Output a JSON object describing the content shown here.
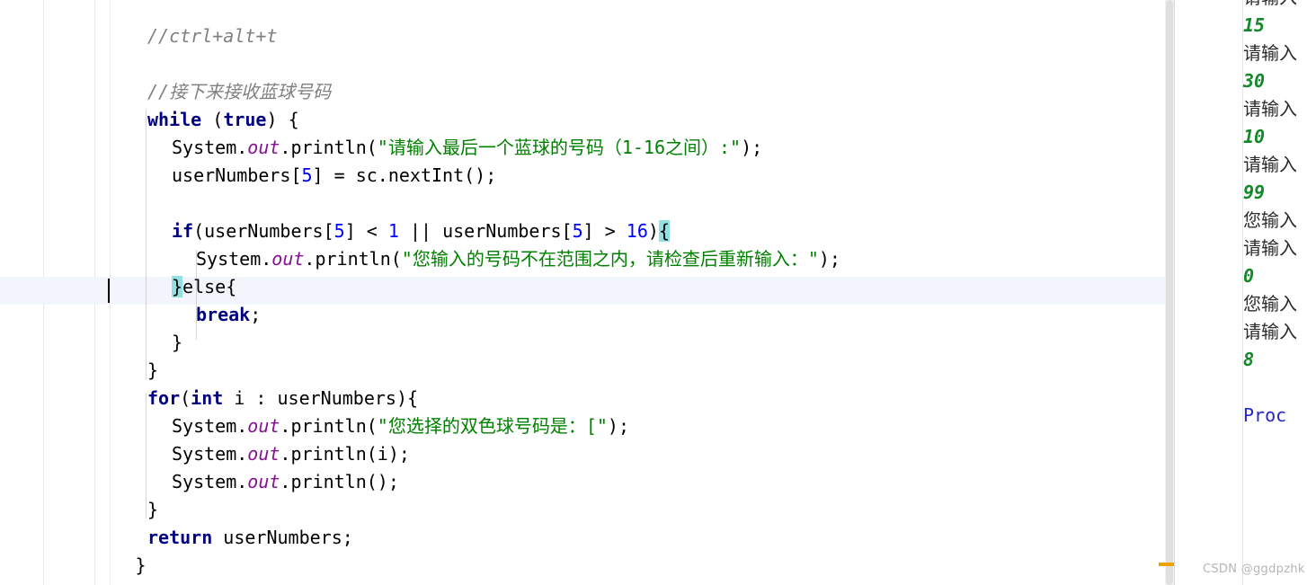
{
  "editor": {
    "language": "java",
    "theme": "IntelliJ Light",
    "font_size_px": 20,
    "line_height_px": 31,
    "caret_line_index": 9,
    "colors": {
      "comment": "#808080",
      "keyword": "#000080",
      "string": "#008000",
      "number": "#0000ff",
      "static_field": "#871094",
      "current_line_bg": "#f2f5fc",
      "bracket_match_bg": "#93e0e3",
      "warn_marker": "#eda200"
    },
    "lines": [
      {
        "indent": 4,
        "tokens": [
          {
            "t": "//ctrl+alt+t",
            "c": "cm"
          }
        ]
      },
      {
        "indent": 0,
        "tokens": []
      },
      {
        "indent": 4,
        "tokens": [
          {
            "t": "//接下来接收蓝球号码",
            "c": "cm"
          }
        ]
      },
      {
        "indent": 4,
        "tokens": [
          {
            "t": "while",
            "c": "kw"
          },
          {
            "t": " (",
            "c": "pl"
          },
          {
            "t": "true",
            "c": "kw"
          },
          {
            "t": ") {",
            "c": "pl"
          }
        ]
      },
      {
        "indent": 6,
        "tokens": [
          {
            "t": "System.",
            "c": "pl"
          },
          {
            "t": "out",
            "c": "fld"
          },
          {
            "t": ".println(",
            "c": "pl"
          },
          {
            "t": "\"请输入最后一个蓝球的号码（1-16之间）:\"",
            "c": "str"
          },
          {
            "t": ");",
            "c": "pl"
          }
        ]
      },
      {
        "indent": 6,
        "tokens": [
          {
            "t": "userNumbers[",
            "c": "pl"
          },
          {
            "t": "5",
            "c": "num"
          },
          {
            "t": "] = sc.nextInt();",
            "c": "pl"
          }
        ]
      },
      {
        "indent": 0,
        "tokens": []
      },
      {
        "indent": 6,
        "tokens": [
          {
            "t": "if",
            "c": "kw"
          },
          {
            "t": "(userNumbers[",
            "c": "pl"
          },
          {
            "t": "5",
            "c": "num"
          },
          {
            "t": "] < ",
            "c": "pl"
          },
          {
            "t": "1",
            "c": "num"
          },
          {
            "t": " || userNumbers[",
            "c": "pl"
          },
          {
            "t": "5",
            "c": "num"
          },
          {
            "t": "] > ",
            "c": "pl"
          },
          {
            "t": "16",
            "c": "num"
          },
          {
            "t": ")",
            "c": "pl"
          },
          {
            "t": "{",
            "c": "brmatch"
          }
        ]
      },
      {
        "indent": 8,
        "tokens": [
          {
            "t": "System.",
            "c": "pl"
          },
          {
            "t": "out",
            "c": "fld"
          },
          {
            "t": ".println(",
            "c": "pl"
          },
          {
            "t": "\"您输入的号码不在范围之内，请检查后重新输入：\"",
            "c": "str"
          },
          {
            "t": ");",
            "c": "pl"
          }
        ]
      },
      {
        "indent": 6,
        "tokens": [
          {
            "t": "}",
            "c": "brmatch"
          },
          {
            "t": "else{",
            "c": "pl"
          }
        ]
      },
      {
        "indent": 8,
        "tokens": [
          {
            "t": "break",
            "c": "kw"
          },
          {
            "t": ";",
            "c": "pl"
          }
        ]
      },
      {
        "indent": 6,
        "tokens": [
          {
            "t": "}",
            "c": "pl"
          }
        ]
      },
      {
        "indent": 4,
        "tokens": [
          {
            "t": "}",
            "c": "pl"
          }
        ]
      },
      {
        "indent": 4,
        "tokens": [
          {
            "t": "for",
            "c": "kw"
          },
          {
            "t": "(",
            "c": "pl"
          },
          {
            "t": "int",
            "c": "kw"
          },
          {
            "t": " i : userNumbers){",
            "c": "pl"
          }
        ]
      },
      {
        "indent": 6,
        "tokens": [
          {
            "t": "System.",
            "c": "pl"
          },
          {
            "t": "out",
            "c": "fld"
          },
          {
            "t": ".println(",
            "c": "pl"
          },
          {
            "t": "\"您选择的双色球号码是：[\"",
            "c": "str"
          },
          {
            "t": ");",
            "c": "pl"
          }
        ]
      },
      {
        "indent": 6,
        "tokens": [
          {
            "t": "System.",
            "c": "pl"
          },
          {
            "t": "out",
            "c": "fld"
          },
          {
            "t": ".println(i);",
            "c": "pl"
          }
        ]
      },
      {
        "indent": 6,
        "tokens": [
          {
            "t": "System.",
            "c": "pl"
          },
          {
            "t": "out",
            "c": "fld"
          },
          {
            "t": ".println();",
            "c": "pl"
          }
        ]
      },
      {
        "indent": 4,
        "tokens": [
          {
            "t": "}",
            "c": "pl"
          }
        ]
      },
      {
        "indent": 4,
        "tokens": [
          {
            "t": "return",
            "c": "kw"
          },
          {
            "t": " userNumbers;",
            "c": "pl"
          }
        ]
      },
      {
        "indent": 3,
        "tokens": [
          {
            "t": "}",
            "c": "pl"
          }
        ]
      }
    ]
  },
  "console": {
    "lines": [
      {
        "text": "请输入",
        "kind": "msg",
        "clipped": true
      },
      {
        "text": "15",
        "kind": "num"
      },
      {
        "text": "请输入",
        "kind": "msg",
        "clipped": true
      },
      {
        "text": "30",
        "kind": "num"
      },
      {
        "text": "请输入",
        "kind": "msg",
        "clipped": true
      },
      {
        "text": "10",
        "kind": "num"
      },
      {
        "text": "请输入",
        "kind": "msg",
        "clipped": true
      },
      {
        "text": "99",
        "kind": "num"
      },
      {
        "text": "您输入",
        "kind": "msg",
        "clipped": true
      },
      {
        "text": "请输入",
        "kind": "msg",
        "clipped": true
      },
      {
        "text": "0",
        "kind": "num"
      },
      {
        "text": "您输入",
        "kind": "msg",
        "clipped": true
      },
      {
        "text": "请输入",
        "kind": "msg",
        "clipped": true
      },
      {
        "text": "8",
        "kind": "num"
      },
      {
        "text": "",
        "kind": "blank"
      },
      {
        "text": "Proc",
        "kind": "proc",
        "clipped": true
      }
    ]
  },
  "watermark": {
    "text": "CSDN @ggdpzhk"
  }
}
